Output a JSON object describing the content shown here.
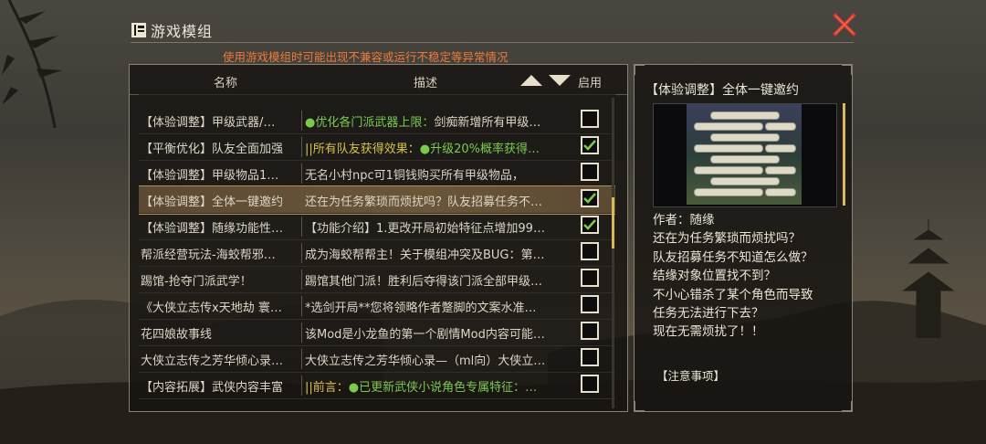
{
  "dialog": {
    "title": "游戏模组",
    "warning": "使用游戏模组时可能出现不兼容或运行不稳定等异常情况"
  },
  "list": {
    "headers": {
      "name": "名称",
      "desc": "描述",
      "enable": "启用"
    },
    "rows": [
      {
        "name": "【体验调整】甲级武器/…",
        "desc_prefix": "",
        "desc_green": "●优化各门派武器上限：",
        "desc_rest": "剑痴新增所有甲级…",
        "enabled": false,
        "selected": false
      },
      {
        "name": "【平衡优化】队友全面加强",
        "desc_prefix": "||所有队友获得效果：",
        "desc_green": "●升级20%概率获得…",
        "desc_rest": "",
        "enabled": true,
        "selected": false
      },
      {
        "name": "【体验调整】甲级物品1…",
        "desc_prefix": "",
        "desc_green": "",
        "desc_rest": "无名小村npc可1铜钱购买所有甲级物品，",
        "enabled": false,
        "selected": false
      },
      {
        "name": "【体验调整】全体一键邀约",
        "desc_prefix": "",
        "desc_green": "",
        "desc_rest": "还在为任务繁琐而烦扰吗？队友招募任务不…",
        "enabled": true,
        "selected": true
      },
      {
        "name": "【体验调整】随缘功能性…",
        "desc_prefix": "",
        "desc_green": "",
        "desc_rest": "【功能介绍】1.更改开局初始特征点增加99…",
        "enabled": true,
        "selected": false
      },
      {
        "name": "帮派经营玩法-海蛟帮邪…",
        "desc_prefix": "",
        "desc_green": "",
        "desc_rest": "成为海蛟帮帮主！关于模组冲突及BUG：第…",
        "enabled": false,
        "selected": false
      },
      {
        "name": "踢馆-抢夺门派武学！",
        "desc_prefix": "",
        "desc_green": "",
        "desc_rest": "踢馆其他门派！胜利后夺得该门派全部甲级…",
        "enabled": false,
        "selected": false
      },
      {
        "name": "《大侠立志传x天地劫 寰…",
        "desc_prefix": "",
        "desc_green": "",
        "desc_rest": "*选剑开局**您将领略作者蹩脚的文案水准…",
        "enabled": false,
        "selected": false
      },
      {
        "name": "花四娘故事线",
        "desc_prefix": "",
        "desc_green": "",
        "desc_rest": "该Mod是小龙鱼的第一个剧情Mod内容可能…",
        "enabled": false,
        "selected": false
      },
      {
        "name": "大侠立志传之芳华倾心录…",
        "desc_prefix": "",
        "desc_green": "",
        "desc_rest": "大侠立志传之芳华倾心录—（ml向）大侠立…",
        "enabled": false,
        "selected": false
      },
      {
        "name": "【内容拓展】武侠内容丰富",
        "desc_prefix": "||前言：",
        "desc_green": "●已更新武侠小说角色专属特征：…",
        "desc_rest": "",
        "enabled": false,
        "selected": false
      }
    ]
  },
  "detail": {
    "title": "【体验调整】全体一键邀约",
    "lines": [
      "作者：随缘",
      "还在为任务繁琐而烦扰吗？",
      "队友招募任务不知道怎么做？",
      "结缘对象位置找不到？",
      "不小心错杀了某个角色而导致",
      "任务无法进行下去？",
      "现在无需烦扰了！！"
    ],
    "notice": "【注意事项】"
  },
  "colors": {
    "warning": "#ec7a3c",
    "check": "#7cc94f",
    "highlight": "#d9c04a",
    "close": "#d33a2c"
  }
}
